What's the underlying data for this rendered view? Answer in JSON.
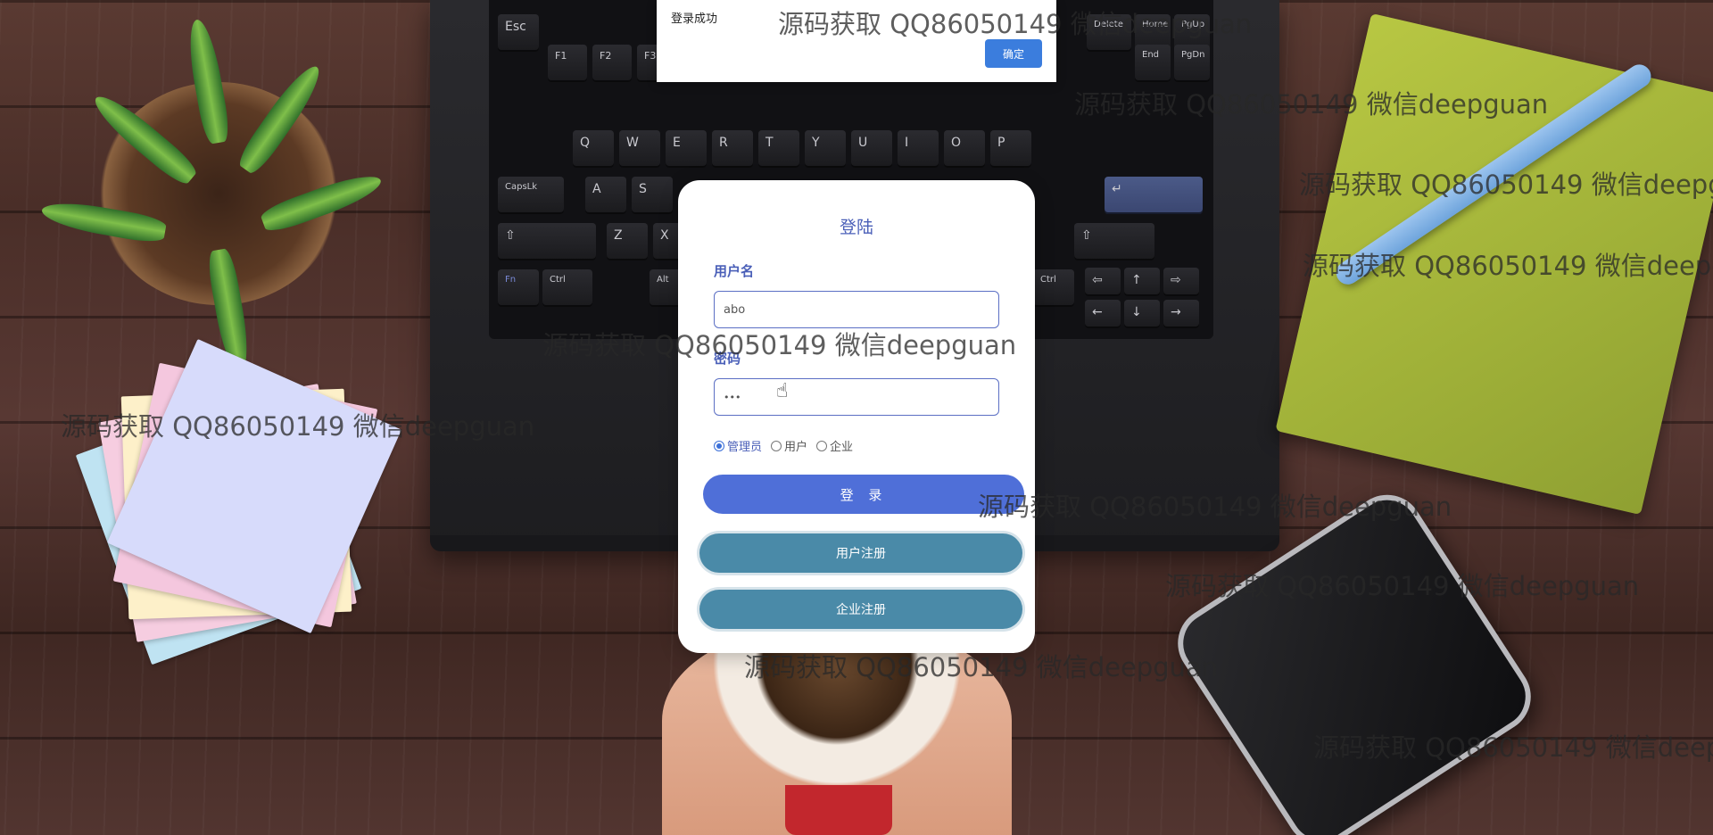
{
  "alert": {
    "message": "登录成功",
    "ok_label": "确定"
  },
  "login": {
    "title": "登陆",
    "username_label": "用户名",
    "username_value": "abo",
    "password_label": "密码",
    "password_value": "•••",
    "roles": [
      {
        "label": "管理员",
        "selected": true
      },
      {
        "label": "用户",
        "selected": false
      },
      {
        "label": "企业",
        "selected": false
      }
    ],
    "login_button": "登 录",
    "user_register_button": "用户注册",
    "company_register_button": "企业注册"
  },
  "watermark": {
    "text": "源码获取 QQ86050149 微信deepguan"
  },
  "keyboard": {
    "keys": [
      "Esc",
      "F1",
      "F2",
      "F3",
      "Delete",
      "Home",
      "PgUp",
      "End",
      "PgDn",
      "Q",
      "W",
      "E",
      "R",
      "T",
      "Y",
      "U",
      "I",
      "O",
      "P",
      "CapsLk",
      "A",
      "S",
      "Z",
      "X",
      "Fn",
      "Ctrl",
      "Alt",
      "Ctrl"
    ]
  },
  "colors": {
    "accent": "#4f6fd8",
    "register_button": "#4a8aa8",
    "label": "#4a5fb8"
  }
}
